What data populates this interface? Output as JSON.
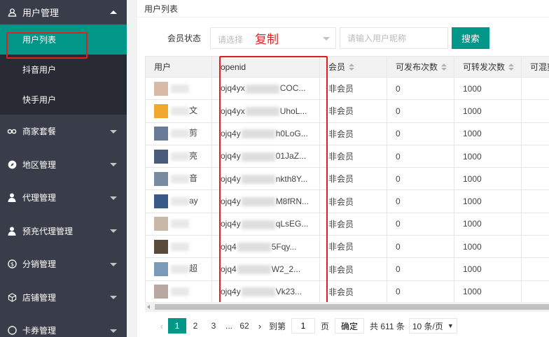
{
  "sidebar": {
    "group_user": "用户管理",
    "sub_items": [
      {
        "label": "用户列表",
        "active": true
      },
      {
        "label": "抖音用户",
        "active": false
      },
      {
        "label": "快手用户",
        "active": false
      }
    ],
    "items": [
      {
        "label": "商家套餐",
        "icon": "link-icon"
      },
      {
        "label": "地区管理",
        "icon": "compass-icon"
      },
      {
        "label": "代理管理",
        "icon": "user-icon"
      },
      {
        "label": "预充代理管理",
        "icon": "user-icon"
      },
      {
        "label": "分销管理",
        "icon": "dollar-icon"
      },
      {
        "label": "店铺管理",
        "icon": "cube-icon"
      },
      {
        "label": "卡券管理",
        "icon": "ticket-icon"
      }
    ]
  },
  "page": {
    "title": "用户列表"
  },
  "filter": {
    "label": "会员状态",
    "select_placeholder": "请选择",
    "copy_note": "复制",
    "input_placeholder": "请输入用户昵称",
    "search_button": "搜索"
  },
  "table": {
    "headers": [
      "用户",
      "openid",
      "会员",
      "可发布次数",
      "可转发次数",
      "可混剪"
    ],
    "rows": [
      {
        "name": "",
        "openid_pre": "ojq4yx",
        "openid_post": "COC...",
        "member": "非会员",
        "publish": "0",
        "forward": "1000"
      },
      {
        "name": "文",
        "openid_pre": "ojq4yx",
        "openid_post": "UhoL...",
        "member": "非会员",
        "publish": "0",
        "forward": "1000"
      },
      {
        "name": "剪",
        "openid_pre": "ojq4y",
        "openid_post": "h0LoG...",
        "member": "非会员",
        "publish": "0",
        "forward": "1000"
      },
      {
        "name": "亮",
        "openid_pre": "ojq4y",
        "openid_post": "01JaZ...",
        "member": "非会员",
        "publish": "0",
        "forward": "1000"
      },
      {
        "name": "音",
        "openid_pre": "ojq4y",
        "openid_post": "nkth8Y...",
        "member": "非会员",
        "publish": "0",
        "forward": "1000"
      },
      {
        "name": "ay",
        "openid_pre": "ojq4y",
        "openid_post": "M8fRN...",
        "member": "非会员",
        "publish": "0",
        "forward": "1000"
      },
      {
        "name": "",
        "openid_pre": "ojq4y",
        "openid_post": "qLsEG...",
        "member": "非会员",
        "publish": "0",
        "forward": "1000"
      },
      {
        "name": "",
        "openid_pre": "ojq4",
        "openid_post": "5Fqy...",
        "member": "非会员",
        "publish": "0",
        "forward": "1000"
      },
      {
        "name": "超",
        "openid_pre": "ojq4",
        "openid_post": "W2_2...",
        "member": "非会员",
        "publish": "0",
        "forward": "1000"
      },
      {
        "name": "",
        "openid_pre": "ojq4y",
        "openid_post": "Vk23...",
        "member": "非会员",
        "publish": "0",
        "forward": "1000"
      }
    ]
  },
  "pager": {
    "pages": [
      "1",
      "2",
      "3"
    ],
    "ellipsis": "...",
    "last_page": "62",
    "goto_label": "到第",
    "goto_value": "1",
    "page_unit": "页",
    "confirm": "确定",
    "total": "共 611 条",
    "page_size": "10 条/页"
  },
  "colors": {
    "sidebar_bg": "#393d49",
    "sidebar_sub_bg": "#282b33",
    "accent": "#009688",
    "annotation_red": "#e02020"
  }
}
